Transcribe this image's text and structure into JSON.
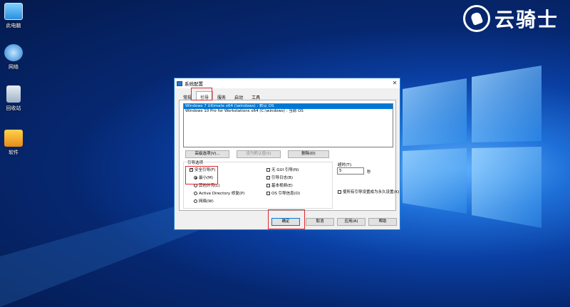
{
  "desktop": {
    "icons": [
      {
        "label": "此电脑"
      },
      {
        "label": "网络"
      },
      {
        "label": "回收站"
      },
      {
        "label": "软件"
      }
    ]
  },
  "brand": {
    "text": "云骑士"
  },
  "dialog": {
    "title": "系统配置",
    "close": "✕",
    "tabs": [
      "常规",
      "引导",
      "服务",
      "启动",
      "工具"
    ],
    "os_list": [
      "Windows 7 Ultimate x64 (\\windows) : 默认 OS",
      "Windows 10 Pro for Workstations x64 (C:\\windows) : 当前 OS"
    ],
    "buttons": {
      "advanced": "高级选项(V)...",
      "set_default": "设为默认值(S)",
      "delete": "删除(D)"
    },
    "boot_options": {
      "label": "引导选项",
      "safe_boot": "安全引导(F)",
      "minimal": "最小(M)",
      "alternate_shell": "其他外壳(L)",
      "ad_repair": "Active Directory 修复(P)",
      "network": "网络(W)",
      "no_gui": "无 GUI 引导(N)",
      "boot_log": "引导日志(B)",
      "base_video": "基本视频(E)",
      "os_info": "OS 引导信息(O)"
    },
    "timeout": {
      "label": "超时(T):",
      "value": "5",
      "unit": "秒"
    },
    "permanent": "使所有引导设置成为永久设置(K)",
    "footer": {
      "ok": "确定",
      "cancel": "取消",
      "apply": "应用(A)",
      "help": "帮助"
    }
  }
}
